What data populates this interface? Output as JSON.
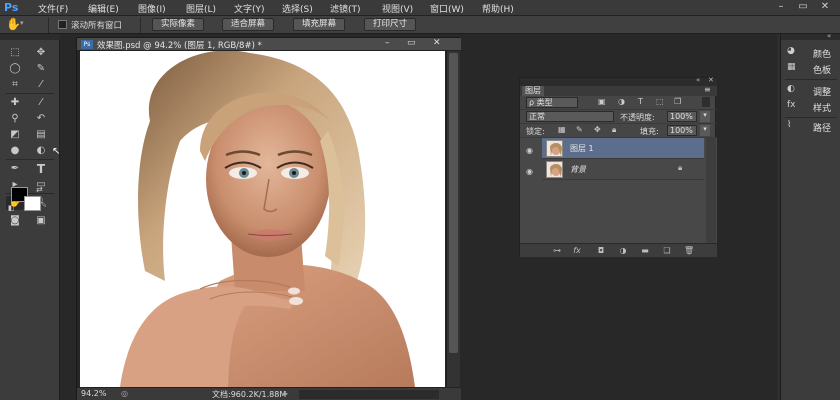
{
  "app": {
    "logo": "Ps",
    "menu": [
      "文件(F)",
      "编辑(E)",
      "图像(I)",
      "图层(L)",
      "文字(Y)",
      "选择(S)",
      "滤镜(T)",
      "视图(V)",
      "窗口(W)",
      "帮助(H)"
    ]
  },
  "options_bar": {
    "scroll_all_label": "滚动所有窗口",
    "buttons": [
      "实际像素",
      "适合屏幕",
      "填充屏幕",
      "打印尺寸"
    ]
  },
  "document": {
    "title": "效果图.psd @ 94.2% (图层 1, RGB/8#) *",
    "zoom": "94.2%",
    "doc_info": "文档:960.2K/1.88M"
  },
  "layers_panel": {
    "tab_label": "图层",
    "filter_kind": "ρ 类型",
    "blend_mode": "正常",
    "opacity_label": "不透明度:",
    "opacity_value": "100%",
    "lock_label": "锁定:",
    "fill_label": "填充:",
    "fill_value": "100%",
    "layers": [
      {
        "name": "图层 1",
        "selected": true
      },
      {
        "name": "背景",
        "selected": false,
        "locked": true
      }
    ],
    "footer_icons": [
      "link-icon",
      "fx-icon",
      "mask-icon",
      "adjustment-icon",
      "group-icon",
      "new-layer-icon",
      "trash-icon"
    ]
  },
  "dock": {
    "items": [
      {
        "icon": "color-icon",
        "label": "颜色"
      },
      {
        "icon": "swatches-icon",
        "label": "色板"
      },
      {
        "icon": "adjustments-icon",
        "label": "调整"
      },
      {
        "icon": "styles-icon",
        "label": "样式"
      },
      {
        "icon": "paths-icon",
        "label": "路径"
      }
    ]
  },
  "colors": {
    "accent": "#4aa3ff",
    "selected_layer": "#5d6e8c",
    "foreground": "#000000",
    "background": "#ffffff"
  }
}
